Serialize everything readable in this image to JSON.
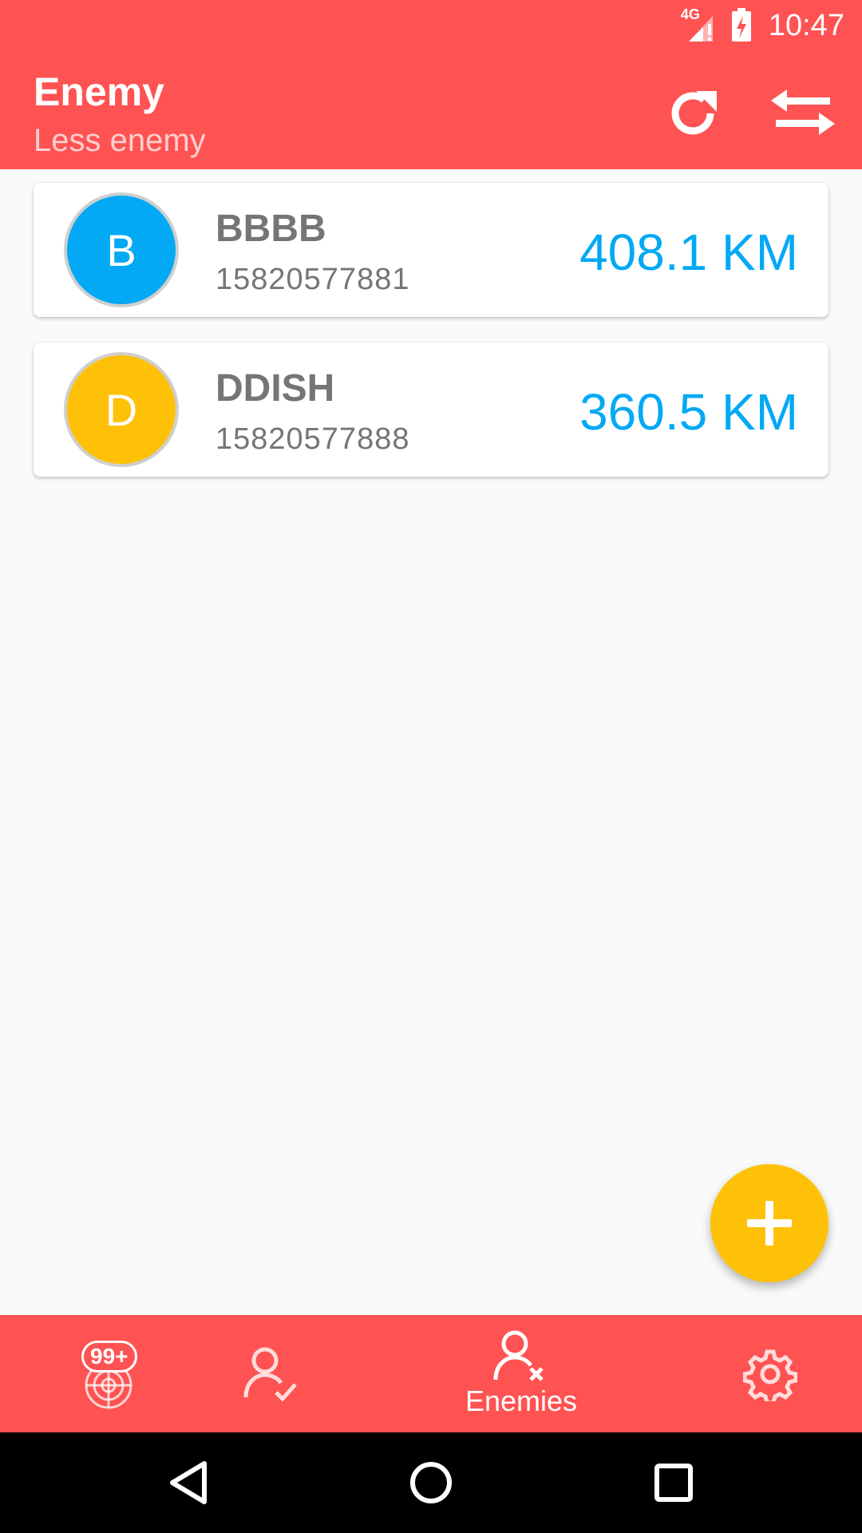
{
  "status_bar": {
    "network": "4G",
    "time": "10:47"
  },
  "app_bar": {
    "title": "Enemy",
    "subtitle": "Less enemy",
    "actions": [
      {
        "icon": "refresh-icon"
      },
      {
        "icon": "swap-icon"
      }
    ]
  },
  "contacts": [
    {
      "initial": "B",
      "name": "BBBB",
      "phone": "15820577881",
      "distance": "408.1 KM",
      "avatar_color": "#03a9f4"
    },
    {
      "initial": "D",
      "name": "DDISH",
      "phone": "15820577888",
      "distance": "360.5 KM",
      "avatar_color": "#ffc107"
    }
  ],
  "fab": {
    "icon": "plus-icon",
    "color": "#ffc107"
  },
  "bottom_nav": {
    "items": [
      {
        "icon": "radar-icon",
        "badge": "99+"
      },
      {
        "icon": "person-check-icon"
      },
      {
        "icon": "person-x-icon",
        "label": "Enemies",
        "selected": true
      },
      {
        "icon": "gear-icon"
      }
    ]
  },
  "colors": {
    "primary": "#ff5252",
    "accent": "#ffc107",
    "distance_text": "#03a9f4"
  }
}
